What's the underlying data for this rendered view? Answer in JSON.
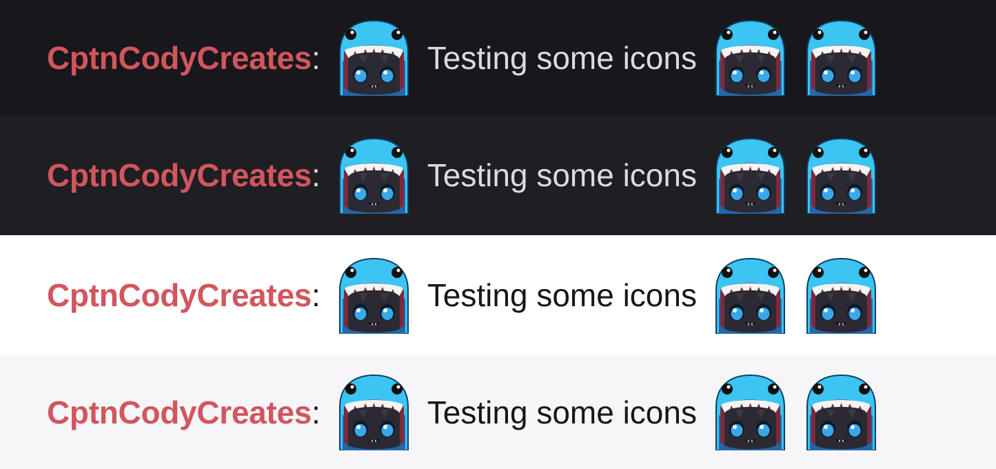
{
  "rows": [
    {
      "theme": "dark",
      "background": "#18171c",
      "username": "CptnCodyCreates",
      "separator": ":",
      "message": "Testing some icons",
      "emote": "shark-hoodie-emote-icon"
    },
    {
      "theme": "dark",
      "background": "#1f1e23",
      "username": "CptnCodyCreates",
      "separator": ":",
      "message": "Testing some icons",
      "emote": "shark-hoodie-emote-icon"
    },
    {
      "theme": "light",
      "background": "#ffffff",
      "username": "CptnCodyCreates",
      "separator": ":",
      "message": "Testing some icons",
      "emote": "shark-hoodie-emote-icon"
    },
    {
      "theme": "light",
      "background": "#f6f6f8",
      "username": "CptnCodyCreates",
      "separator": ":",
      "message": "Testing some icons",
      "emote": "shark-hoodie-emote-icon"
    }
  ],
  "colors": {
    "username": "#d1565e",
    "emote_hood": "#3cc4f2",
    "emote_face": "#2a2a33",
    "emote_eyes": "#3aa8e8"
  }
}
